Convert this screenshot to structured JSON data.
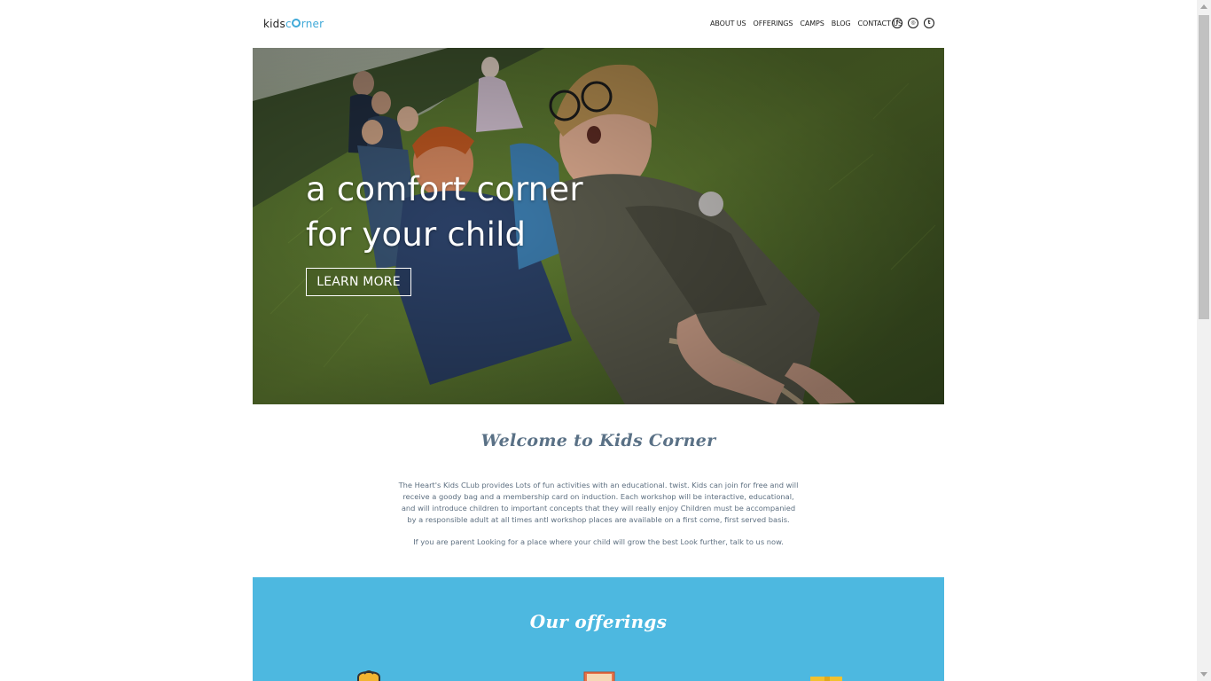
{
  "header": {
    "logo_prefix": "kids",
    "logo_accent": "rner",
    "nav": [
      "ABOUT US",
      "OFFERINGS",
      "CAMPS",
      "BLOG",
      "CONTACT US"
    ],
    "social": [
      {
        "icon": "facebook-icon",
        "glyph": "f"
      },
      {
        "icon": "instagram-icon",
        "glyph": "◎"
      },
      {
        "icon": "twitter-icon",
        "glyph": "t"
      }
    ]
  },
  "hero": {
    "title_line1": "a comfort corner",
    "title_line2": "for your child",
    "button_label": "LEARN MORE"
  },
  "welcome": {
    "title": "Welcome to Kids Corner",
    "paragraph1": "The Heart's Kids CLub provides Lots of fun activities with an educational. twist. Kids can join for free and will receive a goody bag and a membership card on induction. Each workshop will be interactive, educational, and will introduce children to important concepts that they will really enjoy Children must be accompanied by a responsible adult at all times antl workshop places are available on a first come, first served basis.",
    "paragraph2": "If you are parent Looking for a place where your child will grow the best Look further, talk to us now."
  },
  "offerings": {
    "title": "Our offerings"
  },
  "colors": {
    "accent": "#3fa9d8",
    "offerings_bg": "#4db8e0",
    "welcome_title": "#5a7186",
    "body_text": "#5d6f80"
  }
}
